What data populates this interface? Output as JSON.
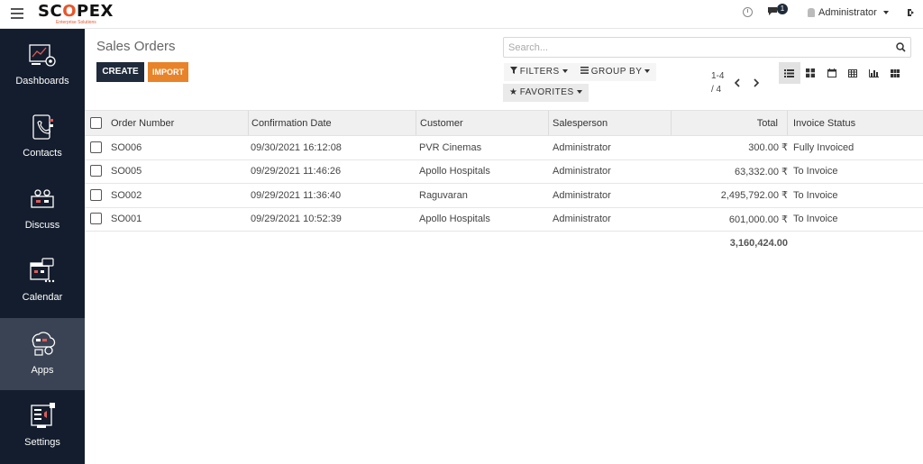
{
  "topbar": {
    "logo_text_a": "SC",
    "logo_text_o": "O",
    "logo_text_b": "PEX",
    "logo_tagline": "Enterprise Solutions",
    "notifications_count": "1",
    "user_name": "Administrator"
  },
  "sidebar": {
    "items": [
      {
        "label": "Dashboards",
        "icon": "dashboards-icon"
      },
      {
        "label": "Contacts",
        "icon": "contacts-icon"
      },
      {
        "label": "Discuss",
        "icon": "discuss-icon"
      },
      {
        "label": "Calendar",
        "icon": "calendar-icon"
      },
      {
        "label": "Apps",
        "icon": "apps-icon"
      },
      {
        "label": "Settings",
        "icon": "settings-icon"
      }
    ],
    "active": "Apps"
  },
  "page": {
    "title": "Sales Orders",
    "create_label": "CREATE",
    "import_label": "IMPORT"
  },
  "search": {
    "placeholder": "Search..."
  },
  "filters": {
    "filters_label": "FILTERS",
    "group_by_label": "GROUP BY",
    "favorites_label": "FAVORITES"
  },
  "pager": {
    "range": "1-4",
    "total": "/ 4"
  },
  "views": [
    "list-view-icon",
    "kanban-view-icon",
    "calendar-view-icon",
    "pivot-view-icon",
    "graph-view-icon",
    "dashboard-view-icon"
  ],
  "table": {
    "headers": {
      "order_number": "Order Number",
      "confirmation_date": "Confirmation Date",
      "customer": "Customer",
      "salesperson": "Salesperson",
      "total": "Total",
      "invoice_status": "Invoice Status"
    },
    "rows": [
      {
        "order_number": "SO006",
        "confirmation_date": "09/30/2021 16:12:08",
        "customer": "PVR Cinemas",
        "salesperson": "Administrator",
        "total": "300.00 ₹",
        "invoice_status": "Fully Invoiced"
      },
      {
        "order_number": "SO005",
        "confirmation_date": "09/29/2021 11:46:26",
        "customer": "Apollo Hospitals",
        "salesperson": "Administrator",
        "total": "63,332.00 ₹",
        "invoice_status": "To Invoice"
      },
      {
        "order_number": "SO002",
        "confirmation_date": "09/29/2021 11:36:40",
        "customer": "Raguvaran",
        "salesperson": "Administrator",
        "total": "2,495,792.00 ₹",
        "invoice_status": "To Invoice"
      },
      {
        "order_number": "SO001",
        "confirmation_date": "09/29/2021 10:52:39",
        "customer": "Apollo Hospitals",
        "salesperson": "Administrator",
        "total": "601,000.00 ₹",
        "invoice_status": "To Invoice"
      }
    ],
    "sum_total": "3,160,424.00"
  },
  "colors": {
    "sidebar_bg": "#141d2d",
    "sidebar_active": "#3a4353",
    "primary_button": "#1f2b3a",
    "import_button": "#e8832a",
    "brand_accent": "#e8562a"
  }
}
